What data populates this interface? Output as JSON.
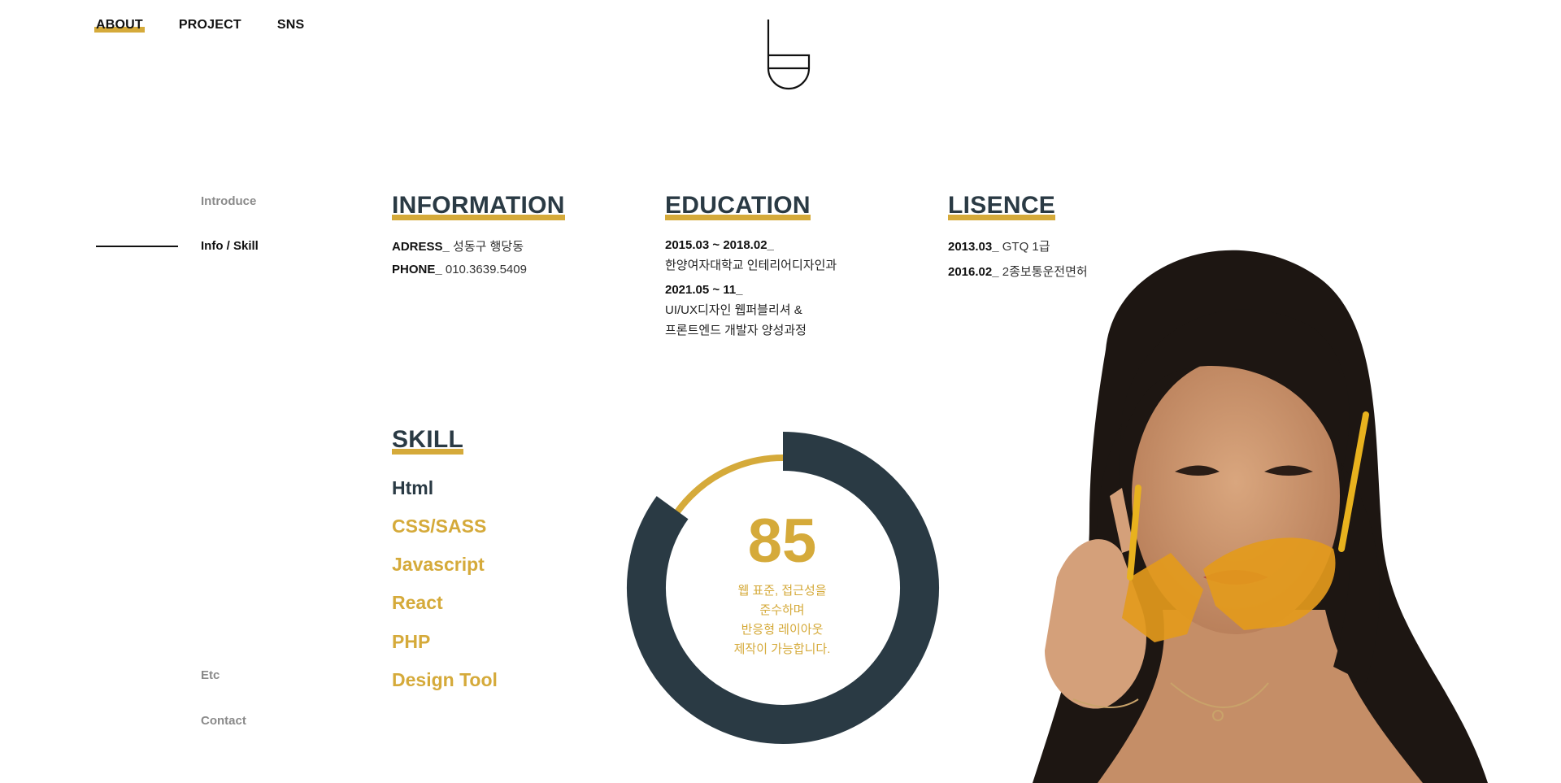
{
  "topnav": {
    "items": [
      {
        "label": "ABOUT",
        "active": true
      },
      {
        "label": "PROJECT",
        "active": false
      },
      {
        "label": "SNS",
        "active": false
      }
    ]
  },
  "sidenav": {
    "items": [
      {
        "label": "Introduce",
        "active": false
      },
      {
        "label": "Info / Skill",
        "active": true
      },
      {
        "label": "Etc",
        "active": false
      },
      {
        "label": "Contact",
        "active": false
      }
    ]
  },
  "information": {
    "title": "INFORMATION",
    "address_label": "ADRESS_",
    "address_value": "성동구 행당동",
    "phone_label": "PHONE_",
    "phone_value": "010.3639.5409"
  },
  "education": {
    "title": "EDUCATION",
    "entries": [
      {
        "date": "2015.03 ~ 2018.02_",
        "lines": [
          "한양여자대학교 인테리어디자인과"
        ]
      },
      {
        "date": "2021.05 ~ 11_",
        "lines": [
          "UI/UX디자인 웹퍼블리셔 &",
          "프론트엔드 개발자 양성과정"
        ]
      }
    ]
  },
  "license": {
    "title": "LISENCE",
    "entries": [
      {
        "date": "2013.03_",
        "name": "GTQ 1급"
      },
      {
        "date": "2016.02_",
        "name": "2종보통운전면허"
      }
    ]
  },
  "skill": {
    "title": "SKILL",
    "items": [
      {
        "label": "Html",
        "active": true
      },
      {
        "label": "CSS/SASS",
        "active": false
      },
      {
        "label": "Javascript",
        "active": false
      },
      {
        "label": "React",
        "active": false
      },
      {
        "label": "PHP",
        "active": false
      },
      {
        "label": "Design Tool",
        "active": false
      }
    ],
    "selected": {
      "percent": 85,
      "percent_text": "85",
      "description": [
        "웹 표준, 접근성을",
        "준수하며",
        "반응형 레이아웃",
        "제작이 가능합니다."
      ]
    }
  },
  "colors": {
    "accent": "#d5aa3a",
    "dark": "#2a3a44"
  },
  "icons": {
    "logo": "brand-logo-icon"
  }
}
